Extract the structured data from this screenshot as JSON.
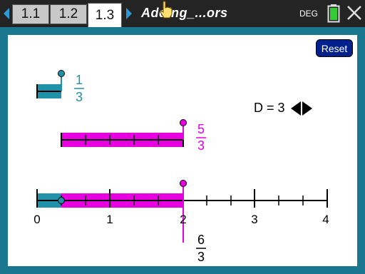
{
  "tabs": [
    {
      "label": "1.1",
      "active": false
    },
    {
      "label": "1.2",
      "active": false
    },
    {
      "label": "1.3",
      "active": true
    }
  ],
  "document_title": "Adding_...ors",
  "angle_mode": "DEG",
  "reset_label": "Reset",
  "denominator": {
    "label": "D = 3",
    "value": 3
  },
  "fraction_a": {
    "numerator": "1",
    "denominator": "3",
    "value": 0.3333
  },
  "fraction_b": {
    "numerator": "5",
    "denominator": "3",
    "value": 1.6667
  },
  "sum_fraction": {
    "numerator": "6",
    "denominator": "3",
    "value": 2
  },
  "number_line": {
    "min": 0,
    "max": 4,
    "tick_labels": [
      "0",
      "1",
      "2",
      "3",
      "4"
    ]
  },
  "colors": {
    "teal": "#1f91a8",
    "magenta": "#e800e0",
    "frame": "#1b7690",
    "tab_arrow": "#2a9ad6",
    "reset_bg": "#00208c",
    "battery": "#33cc33"
  }
}
